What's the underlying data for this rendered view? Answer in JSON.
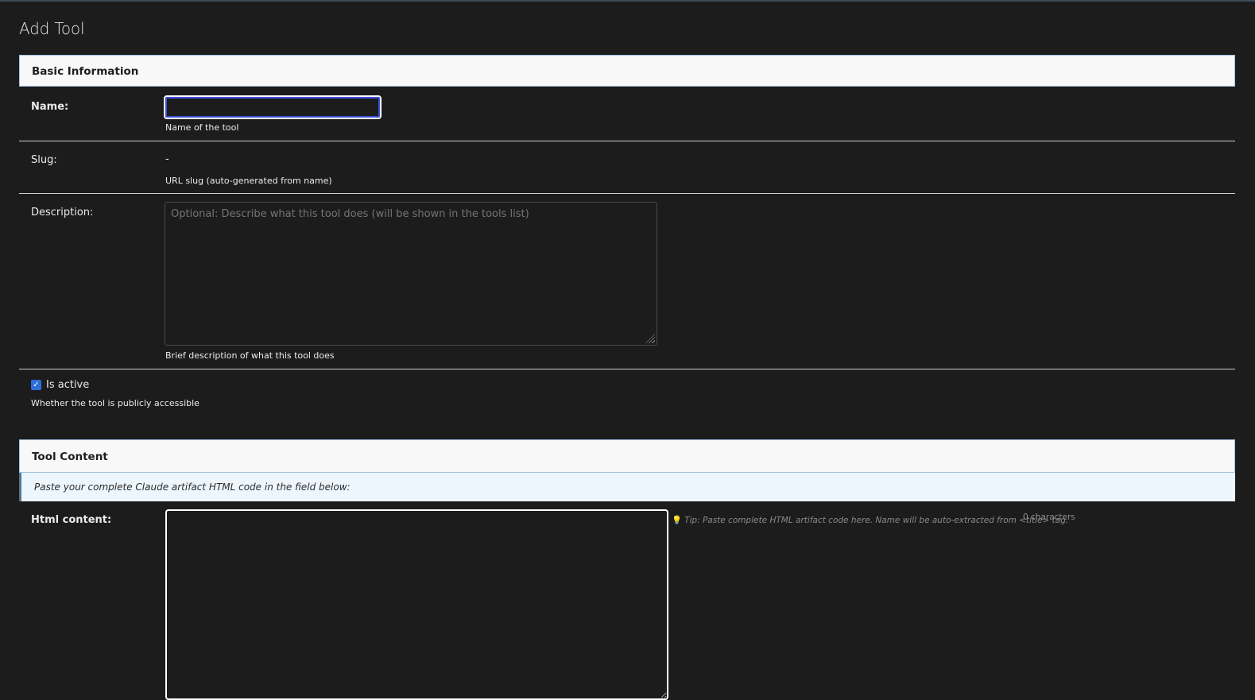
{
  "page": {
    "title": "Add Tool"
  },
  "basic_info": {
    "header": "Basic Information",
    "name": {
      "label": "Name:",
      "value": "",
      "help": "Name of the tool"
    },
    "slug": {
      "label": "Slug:",
      "value": "-",
      "help": "URL slug (auto-generated from name)"
    },
    "description": {
      "label": "Description:",
      "placeholder": "Optional: Describe what this tool does (will be shown in the tools list)",
      "value": "",
      "help": "Brief description of what this tool does"
    },
    "is_active": {
      "label": "Is active",
      "checked": true,
      "help": "Whether the tool is publicly accessible"
    }
  },
  "tool_content": {
    "header": "Tool Content",
    "banner": "Paste your complete Claude artifact HTML code in the field below:",
    "html_content": {
      "label": "Html content:",
      "value": "",
      "tip_icon": "lightbulb-icon",
      "tip": "Tip: Paste complete HTML artifact code here. Name will be auto-extracted from <title> tag.",
      "char_count": "0 characters"
    }
  },
  "colors": {
    "background": "#1c1c1d",
    "header_background": "#f8f8f8",
    "banner_background": "#eef6fd",
    "checkbox_accent": "#2f6ddb",
    "focus_ring": "#3d4fd6"
  }
}
